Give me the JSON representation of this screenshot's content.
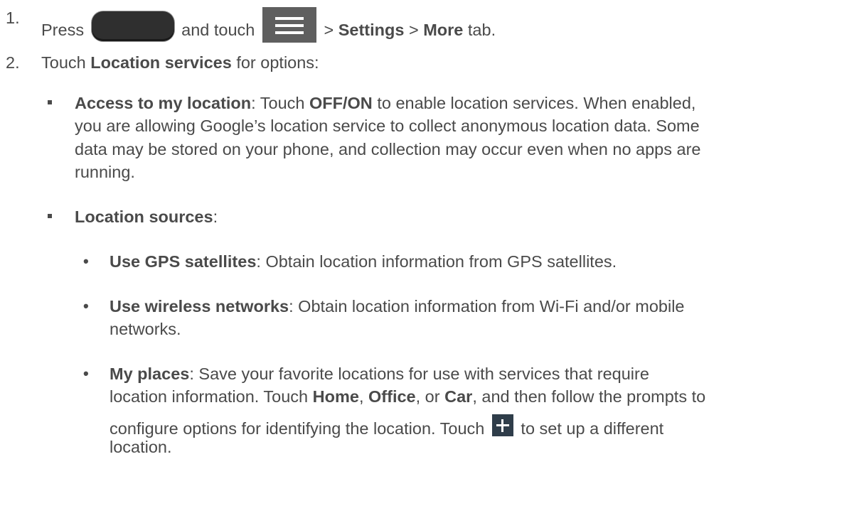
{
  "step1": {
    "number": "1.",
    "press": "Press",
    "and_touch": "and touch",
    "sep1": ">",
    "settings": "Settings",
    "sep2": ">",
    "more": "More",
    "tab": "tab."
  },
  "step2": {
    "number": "2.",
    "touch": "Touch",
    "location_services": "Location services",
    "for_options": "for options:"
  },
  "access": {
    "title": "Access to my location",
    "t1": ": Touch",
    "offon": "OFF/ON",
    "t2": "to enable location services. When enabled,",
    "line2": "you are allowing Google’s location service to collect anonymous location data. Some",
    "line3": "data may be stored on your phone, and collection may occur even when no apps are",
    "line4": "running."
  },
  "sources": {
    "title": "Location sources",
    "colon": ":"
  },
  "gps": {
    "title": "Use GPS satellites",
    "text": ": Obtain location information from GPS satellites."
  },
  "wireless": {
    "title": "Use wireless networks",
    "text": ": Obtain location information from Wi-Fi and/or mobile",
    "line2": "networks."
  },
  "places": {
    "title": "My places",
    "t1": ": Save your favorite locations for use with services that require",
    "l2a": "location information. Touch",
    "home": "Home",
    "comma1": ",",
    "office": "Office",
    "l2b": ", or",
    "car": "Car",
    "l2c": ", and then follow the prompts to",
    "l3a": "configure options for identifying the location. Touch",
    "l3b": "to set up a different",
    "l4": "location."
  },
  "bullet_dot": "•"
}
